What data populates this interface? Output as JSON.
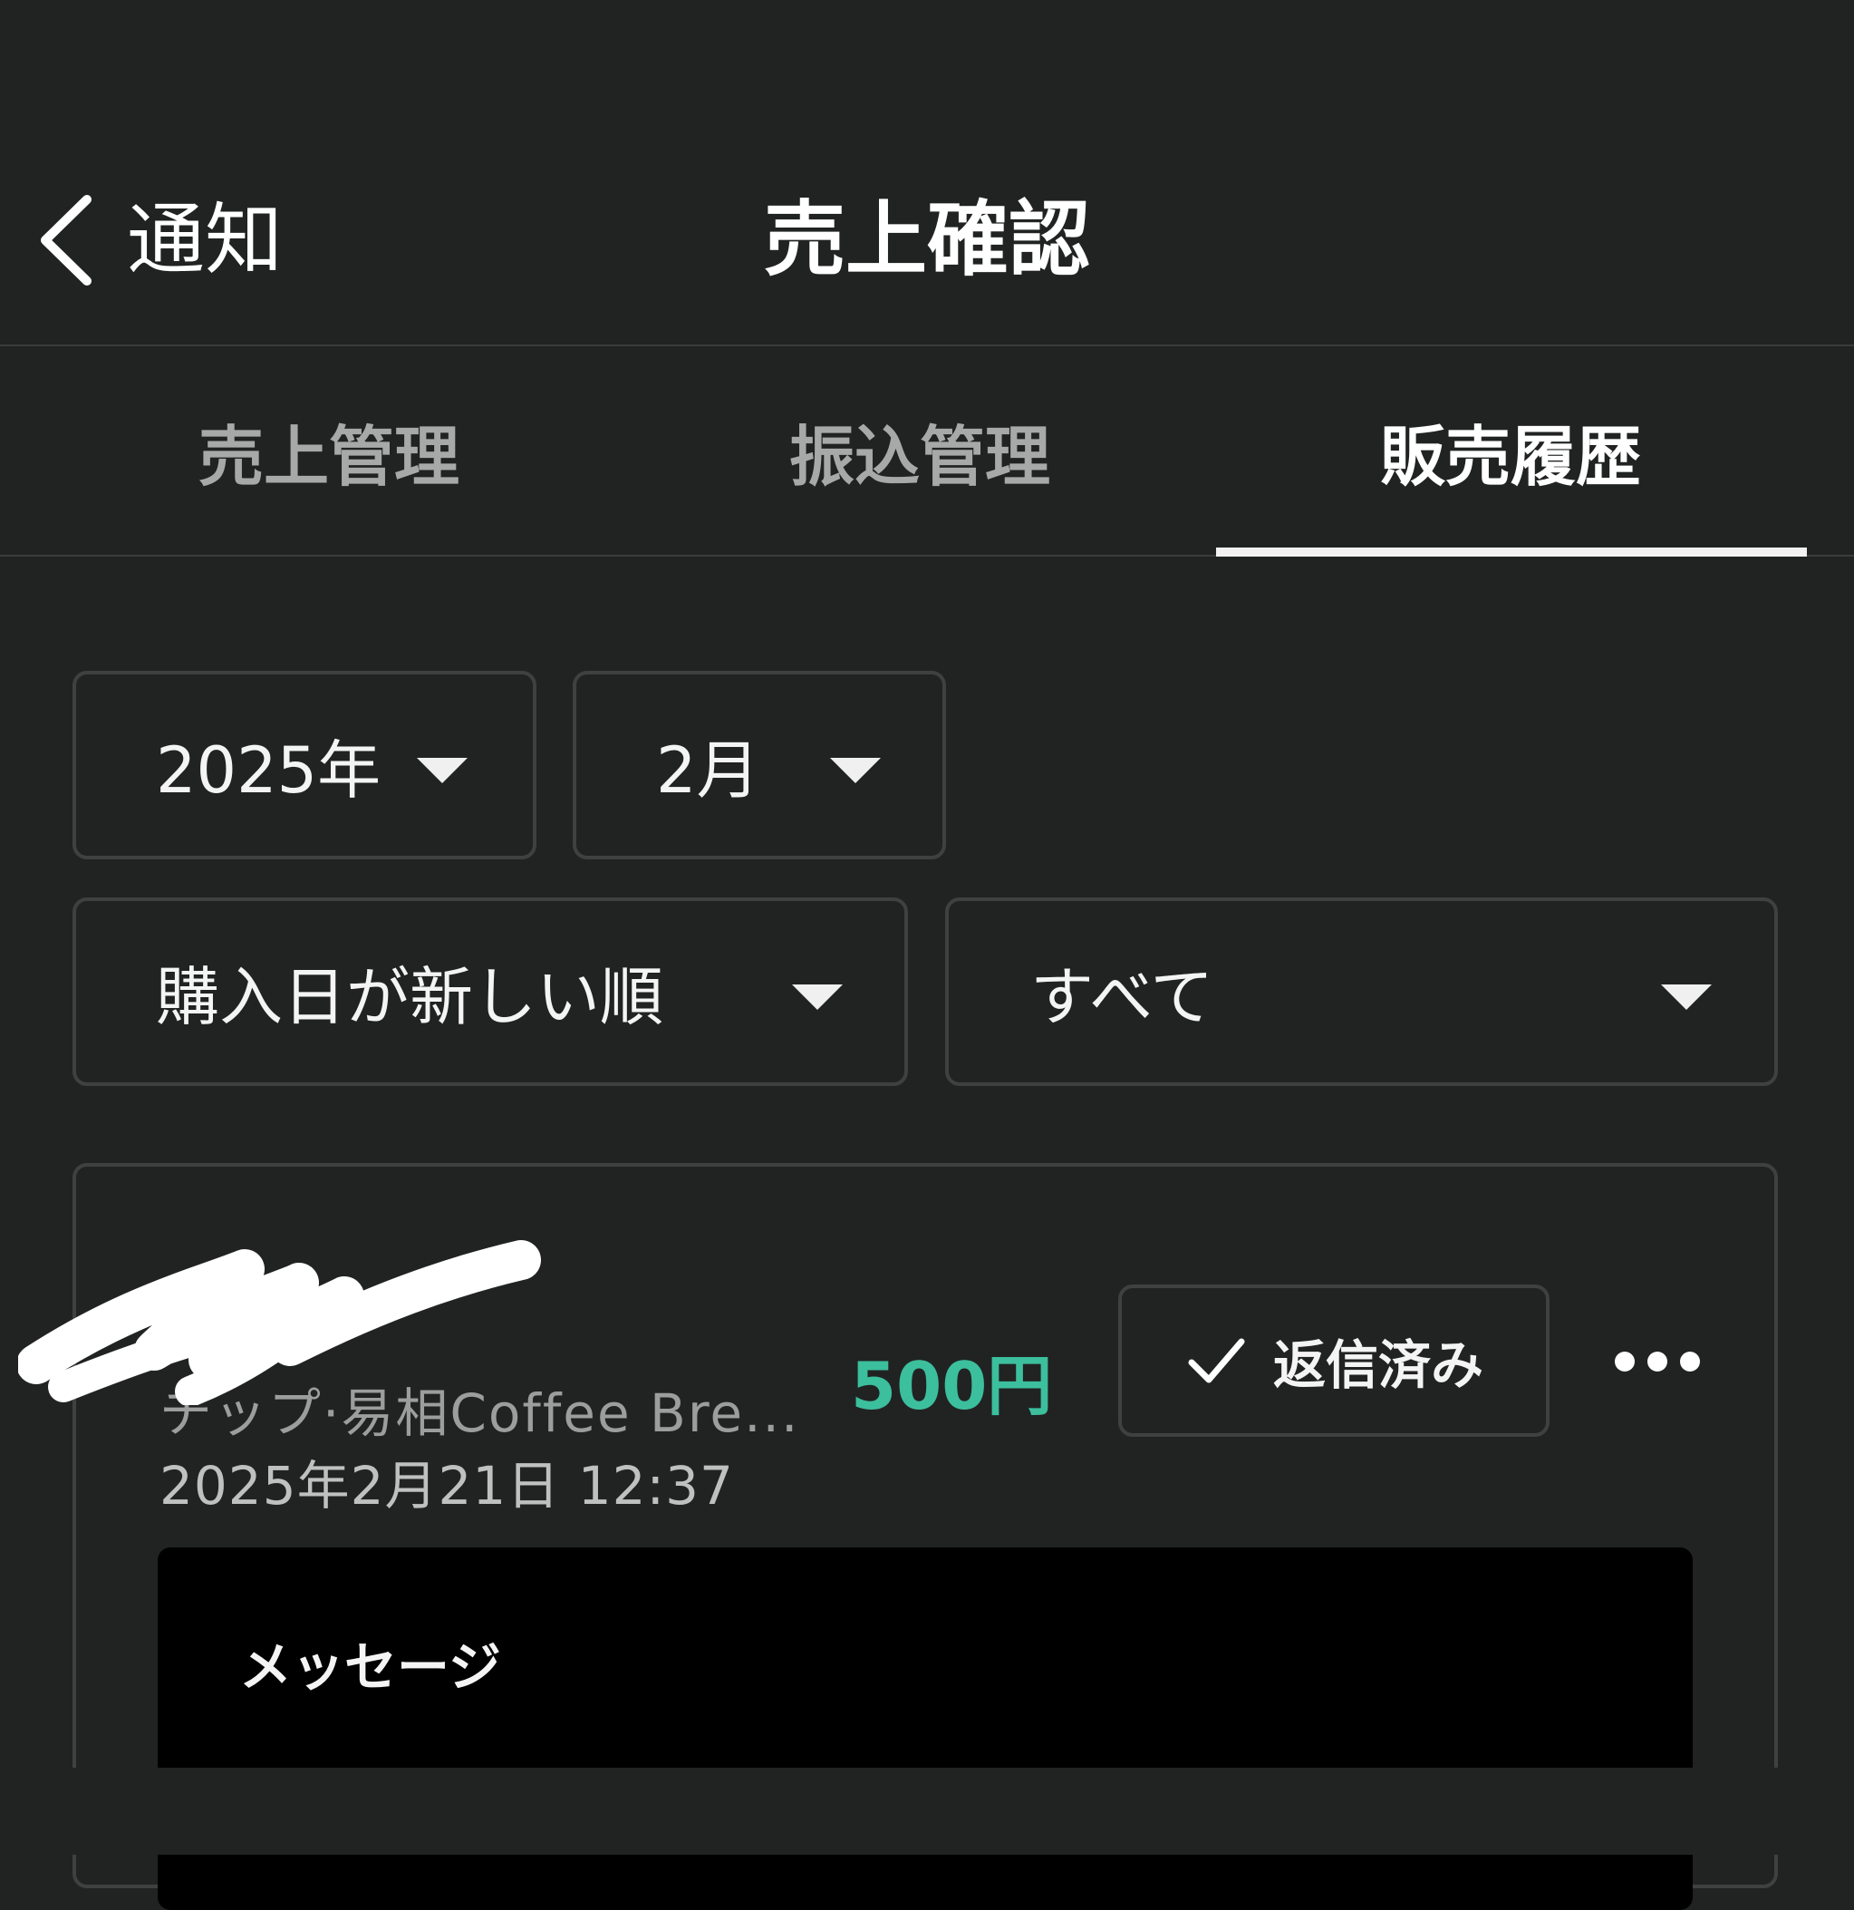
{
  "header": {
    "back_label": "通知",
    "title": "売上確認"
  },
  "tabs": [
    {
      "label": "売上管理",
      "active": false
    },
    {
      "label": "振込管理",
      "active": false
    },
    {
      "label": "販売履歴",
      "active": true
    }
  ],
  "filters": {
    "year": "2025年",
    "month": "2月",
    "sort": "購入日が新しい順",
    "status": "すべて"
  },
  "sale": {
    "product_name": "チップ·易相Coffee Bre...",
    "purchased_at": "2025年2月21日 12:37",
    "price": "500円",
    "reply_status": "返信済み",
    "message_title": "メッセージ"
  },
  "colors": {
    "background": "#212323",
    "price_accent": "#3cbf9d",
    "border": "#3f4141",
    "message_panel": "#000000"
  },
  "icons": {
    "back": "chevron-left-icon",
    "dropdown": "caret-down-icon",
    "check": "check-icon",
    "more": "more-horizontal-icon"
  }
}
